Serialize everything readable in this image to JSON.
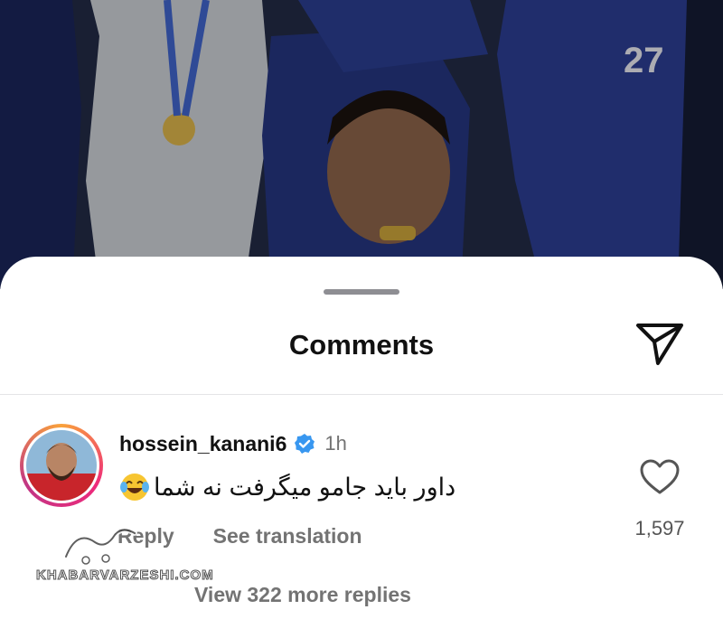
{
  "sheet": {
    "title": "Comments"
  },
  "comment": {
    "username": "hossein_kanani6",
    "time": "1h",
    "text": "داور باید جامو میگرفت نه شما",
    "emoji": "face-with-tears-of-joy",
    "like_count": "1,597",
    "reply_label": "Reply",
    "translate_label": "See translation",
    "more_replies_label": "View 322 more replies"
  },
  "watermark": {
    "text": "KHABARVARZESHI.COM"
  },
  "colors": {
    "jersey_blue": "#2c3e8c",
    "verified_blue": "#3897f0",
    "muted_text": "#737373"
  }
}
